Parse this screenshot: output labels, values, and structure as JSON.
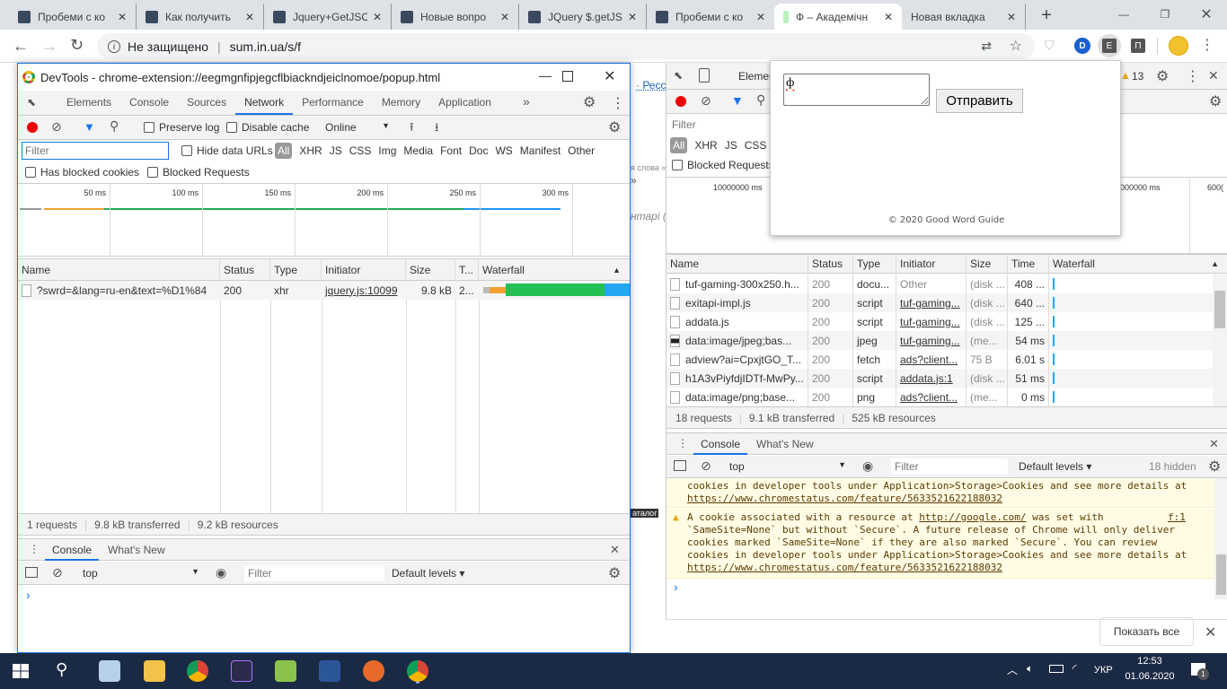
{
  "browser": {
    "tabs": [
      {
        "title": "Пробеми с ко"
      },
      {
        "title": "Как получить"
      },
      {
        "title": "Jquery+GetJSO"
      },
      {
        "title": "Новые вопро"
      },
      {
        "title": "JQuery $.getJS"
      },
      {
        "title": "Пробеми с ко"
      },
      {
        "title": "Ф – Академічн",
        "active": true
      },
      {
        "title": "Новая вкладка"
      }
    ],
    "new_tab": "+",
    "security_label": "Не защищено",
    "url": "sum.in.ua/s/f",
    "extensions": [
      "D",
      "E",
      "П"
    ]
  },
  "background_page": {
    "link_fragment": "· Ресс",
    "word_fragment": "я слова «",
    "quote_fragment": "»",
    "comment_fragment": "нтарі (0",
    "catalog_fragment": "аталог"
  },
  "devtools_window": {
    "title": "DevTools - chrome-extension://eegmgnfipjegcflbiackndjeiclnomoe/popup.html",
    "panels": [
      "Elements",
      "Console",
      "Sources",
      "Network",
      "Performance",
      "Memory",
      "Application"
    ],
    "active_panel": "Network",
    "more": "»",
    "preserve_log": "Preserve log",
    "disable_cache": "Disable cache",
    "throttle": "Online",
    "filter_placeholder": "Filter",
    "hide_data_urls": "Hide data URLs",
    "types": [
      "All",
      "XHR",
      "JS",
      "CSS",
      "Img",
      "Media",
      "Font",
      "Doc",
      "WS",
      "Manifest",
      "Other"
    ],
    "has_blocked_cookies": "Has blocked cookies",
    "blocked_requests": "Blocked Requests",
    "timeline_ticks": [
      "50 ms",
      "100 ms",
      "150 ms",
      "200 ms",
      "250 ms",
      "300 ms"
    ],
    "columns": [
      "Name",
      "Status",
      "Type",
      "Initiator",
      "Size",
      "T...",
      "Waterfall"
    ],
    "rows": [
      {
        "name": "?swrd=&lang=ru-en&text=%D1%84",
        "status": "200",
        "type": "xhr",
        "initiator": "jquery.js:10099",
        "size": "9.8 kB",
        "time": "2..."
      }
    ],
    "summary": {
      "requests": "1 requests",
      "transferred": "9.8 kB transferred",
      "resources": "9.2 kB resources"
    },
    "drawer_tabs": [
      "Console",
      "What's New"
    ],
    "context": "top",
    "console_filter": "Filter",
    "levels": "Default levels ▾",
    "prompt": "›"
  },
  "docked_devtools": {
    "panel_fragment": "Elemen",
    "warning_count": "13",
    "filter_placeholder": "Filter",
    "types": [
      "All",
      "XHR",
      "JS",
      "CSS"
    ],
    "types_tail": "s",
    "blocked_requests": "Blocked Requests",
    "timeline_ticks": [
      "10000000 ms",
      "000000 ms",
      "600("
    ],
    "columns": [
      "Name",
      "Status",
      "Type",
      "Initiator",
      "Size",
      "Time",
      "Waterfall"
    ],
    "rows": [
      {
        "name": "tuf-gaming-300x250.h...",
        "status": "200",
        "type": "docu...",
        "initiator": "Other",
        "initiator_link": false,
        "size": "(disk ...",
        "time": "408 ..."
      },
      {
        "name": "exitapi-impl.js",
        "status": "200",
        "type": "script",
        "initiator": "tuf-gaming...",
        "initiator_link": true,
        "size": "(disk ...",
        "time": "640 ..."
      },
      {
        "name": "addata.js",
        "status": "200",
        "type": "script",
        "initiator": "tuf-gaming...",
        "initiator_link": true,
        "size": "(disk ...",
        "time": "125 ..."
      },
      {
        "name": "data:image/jpeg;bas...",
        "status": "200",
        "type": "jpeg",
        "initiator": "tuf-gaming...",
        "initiator_link": true,
        "size": "(me...",
        "time": "54 ms"
      },
      {
        "name": "adview?ai=CpxjtGO_T...",
        "status": "200",
        "type": "fetch",
        "initiator": "ads?client...",
        "initiator_link": true,
        "size": "75 B",
        "time": "6.01 s"
      },
      {
        "name": "h1A3vPiyfdjIDTf-MwPy...",
        "status": "200",
        "type": "script",
        "initiator": "addata.js:1",
        "initiator_link": true,
        "size": "(disk ...",
        "time": "51 ms"
      },
      {
        "name": "data:image/png;base...",
        "status": "200",
        "type": "png",
        "initiator": "ads?client...",
        "initiator_link": true,
        "size": "(me...",
        "time": "0 ms"
      }
    ],
    "summary": {
      "requests": "18 requests",
      "transferred": "9.1 kB transferred",
      "resources": "525 kB resources"
    },
    "drawer_tabs": [
      "Console",
      "What's New"
    ],
    "context": "top",
    "console_filter": "Filter",
    "levels": "Default levels ▾",
    "hidden": "18 hidden",
    "messages": {
      "first_tail_text": "cookies in developer tools under Application>Storage>Cookies and see more details at",
      "first_tail_link": "https://www.chromestatus.com/feature/5633521622188032",
      "second_pre": "A cookie associated with a resource at ",
      "second_link": "http://google.com/",
      "second_post": " was set with",
      "second_source": "f:1",
      "second_lines": [
        "`SameSite=None` but without `Secure`. A future release of Chrome will only deliver",
        "cookies marked `SameSite=None` if they are also marked `Secure`. You can review",
        "cookies in developer tools under Application>Storage>Cookies and see more details at"
      ],
      "second_url": "https://www.chromestatus.com/feature/5633521622188032"
    },
    "prompt": "›"
  },
  "popup": {
    "textarea_value": "ф",
    "submit": "Отправить",
    "footer": "© 2020 Good Word Guide"
  },
  "downloads_bar": {
    "show_all": "Показать все"
  },
  "taskbar": {
    "language": "УКР",
    "time": "12:53",
    "date": "01.06.2020",
    "notifications": "1"
  }
}
